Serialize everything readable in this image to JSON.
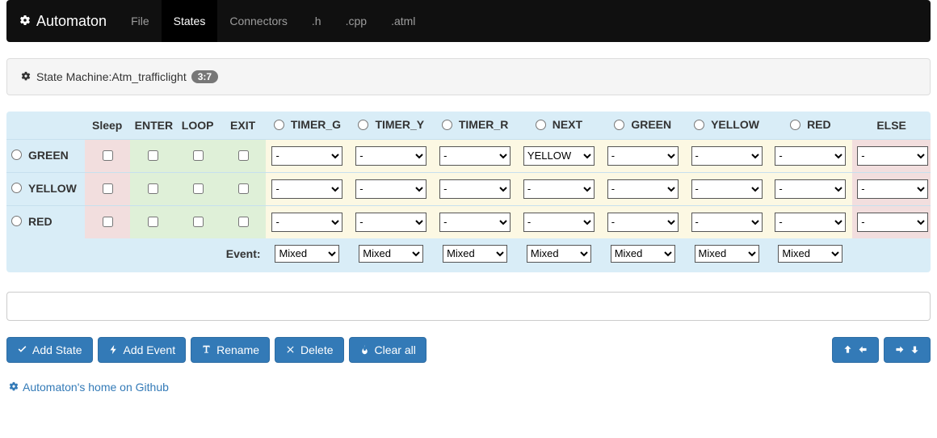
{
  "nav": {
    "brand": "Automaton",
    "items": [
      "File",
      "States",
      "Connectors",
      ".h",
      ".cpp",
      ".atml"
    ],
    "active": "States"
  },
  "panel": {
    "label_prefix": "State Machine: ",
    "machine_name": "Atm_trafficlight",
    "badge": "3:7"
  },
  "table": {
    "headers_fixed": [
      "Sleep",
      "ENTER",
      "LOOP",
      "EXIT"
    ],
    "event_headers": [
      "TIMER_G",
      "TIMER_Y",
      "TIMER_R",
      "NEXT",
      "GREEN",
      "YELLOW",
      "RED"
    ],
    "else_header": "ELSE",
    "states": [
      {
        "name": "GREEN",
        "events": [
          "-",
          "-",
          "-",
          "YELLOW",
          "-",
          "-",
          "-"
        ],
        "else": "-"
      },
      {
        "name": "YELLOW",
        "events": [
          "-",
          "-",
          "-",
          "-",
          "-",
          "-",
          "-"
        ],
        "else": "-"
      },
      {
        "name": "RED",
        "events": [
          "-",
          "-",
          "-",
          "-",
          "-",
          "-",
          "-"
        ],
        "else": "-"
      }
    ],
    "event_row_label": "Event:",
    "event_row_values": [
      "Mixed",
      "Mixed",
      "Mixed",
      "Mixed",
      "Mixed",
      "Mixed",
      "Mixed"
    ]
  },
  "buttons": {
    "add_state": "Add State",
    "add_event": "Add Event",
    "rename": "Rename",
    "delete": "Delete",
    "clear_all": "Clear all"
  },
  "footer_link": "Automaton's home on Github"
}
